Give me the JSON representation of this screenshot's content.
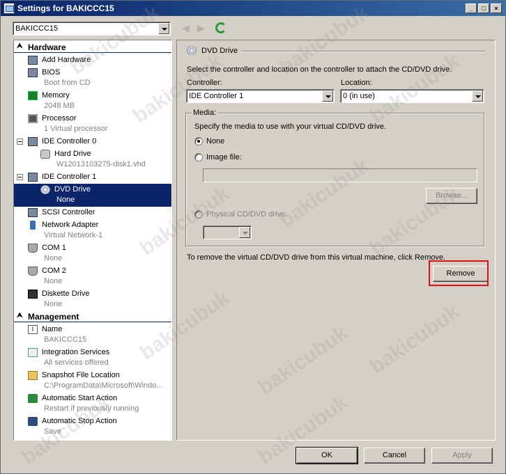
{
  "window": {
    "title": "Settings for BAKICCC15"
  },
  "vm_selector": {
    "value": "BAKICCC15"
  },
  "tree": {
    "hardware_header": "Hardware",
    "management_header": "Management",
    "items": [
      {
        "label": "Add Hardware",
        "sub": ""
      },
      {
        "label": "BIOS",
        "sub": "Boot from CD"
      },
      {
        "label": "Memory",
        "sub": "2048 MB"
      },
      {
        "label": "Processor",
        "sub": "1 Virtual processor"
      },
      {
        "label": "IDE Controller 0",
        "sub": ""
      },
      {
        "label": "Hard Drive",
        "sub": "W12013103275-disk1.vhd"
      },
      {
        "label": "IDE Controller 1",
        "sub": ""
      },
      {
        "label": "DVD Drive",
        "sub": "None"
      },
      {
        "label": "SCSI Controller",
        "sub": ""
      },
      {
        "label": "Network Adapter",
        "sub": "Virtual Network-1"
      },
      {
        "label": "COM 1",
        "sub": "None"
      },
      {
        "label": "COM 2",
        "sub": "None"
      },
      {
        "label": "Diskette Drive",
        "sub": "None"
      }
    ],
    "mgmt_items": [
      {
        "label": "Name",
        "sub": "BAKICCC15"
      },
      {
        "label": "Integration Services",
        "sub": "All services offered"
      },
      {
        "label": "Snapshot File Location",
        "sub": "C:\\ProgramData\\Microsoft\\Windo..."
      },
      {
        "label": "Automatic Start Action",
        "sub": "Restart if previously running"
      },
      {
        "label": "Automatic Stop Action",
        "sub": "Save"
      }
    ]
  },
  "panel": {
    "heading": "DVD Drive",
    "instructions": "Select the controller and location on the controller to attach the CD/DVD drive.",
    "controller_label": "Controller:",
    "controller_value": "IDE Controller 1",
    "location_label": "Location:",
    "location_value": "0 (in use)",
    "media_label": "Media:",
    "media_instructions": "Specify the media to use with your virtual CD/DVD drive.",
    "none_label": "None",
    "image_file_label": "Image file:",
    "browse_label": "Browse...",
    "physical_label": "Physical CD/DVD drive:",
    "remove_instructions": "To remove the virtual CD/DVD drive from this virtual machine, click Remove.",
    "remove_label": "Remove"
  },
  "footer": {
    "ok": "OK",
    "cancel": "Cancel",
    "apply": "Apply"
  },
  "watermark": "bakicubuk"
}
